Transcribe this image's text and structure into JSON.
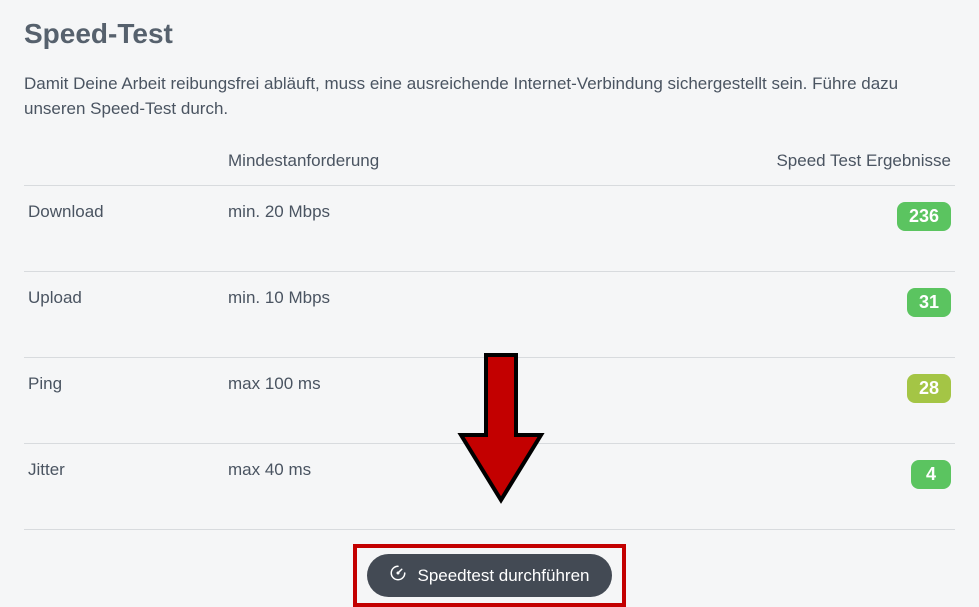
{
  "title": "Speed-Test",
  "intro": "Damit Deine Arbeit reibungsfrei abläuft, muss eine ausreichende Internet-Verbindung sichergestellt sein. Führe dazu unseren Speed-Test durch.",
  "table": {
    "header_requirement": "Mindestanforderung",
    "header_result": "Speed Test Ergebnisse",
    "rows": [
      {
        "metric": "Download",
        "requirement": "min. 20 Mbps",
        "result": "236",
        "status": "green"
      },
      {
        "metric": "Upload",
        "requirement": "min. 10 Mbps",
        "result": "31",
        "status": "green"
      },
      {
        "metric": "Ping",
        "requirement": "max 100 ms",
        "result": "28",
        "status": "olive"
      },
      {
        "metric": "Jitter",
        "requirement": "max 40 ms",
        "result": "4",
        "status": "green"
      }
    ]
  },
  "button_label": "Speedtest durchführen"
}
